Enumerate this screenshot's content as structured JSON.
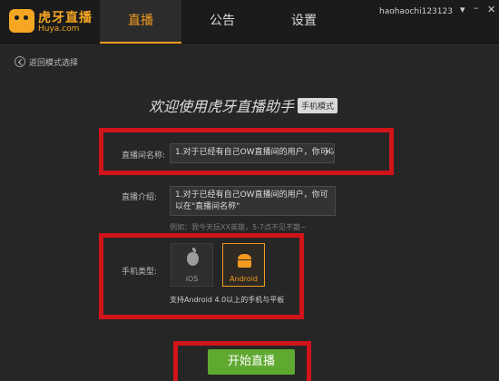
{
  "header": {
    "logo_cn": "虎牙直播",
    "logo_en": "Huya.com",
    "tabs": [
      {
        "label": "直播"
      },
      {
        "label": "公告"
      },
      {
        "label": "设置"
      }
    ],
    "username": "haohaochi123123",
    "window_menu": "▾",
    "window_min": "–",
    "window_close": "✕"
  },
  "back": {
    "label": "返回模式选择"
  },
  "welcome": {
    "title": "欢迎使用虎牙直播助手",
    "badge": "手机模式"
  },
  "form": {
    "title_label": "直播间名称:",
    "title_value": "1.对于已经有自己OW直播间的用户，你可以",
    "title_caret": "▾",
    "intro_label": "直播介绍:",
    "intro_value": "1.对于已经有自己OW直播间的用户，你可以在\"直播间名称\"",
    "intro_hint": "例如：我今天玩XX英雄，5-7点不见不散~",
    "phone_label": "手机类型:",
    "phones": [
      {
        "label": "iOS"
      },
      {
        "label": "Android"
      }
    ],
    "selected_phone": "Android",
    "support_text": "支持Android 4.0以上的手机与平板"
  },
  "start_button": "开始直播",
  "colors": {
    "accent": "#f29b1f",
    "start_button": "#5fa930",
    "highlight_box": "#d1141b"
  }
}
